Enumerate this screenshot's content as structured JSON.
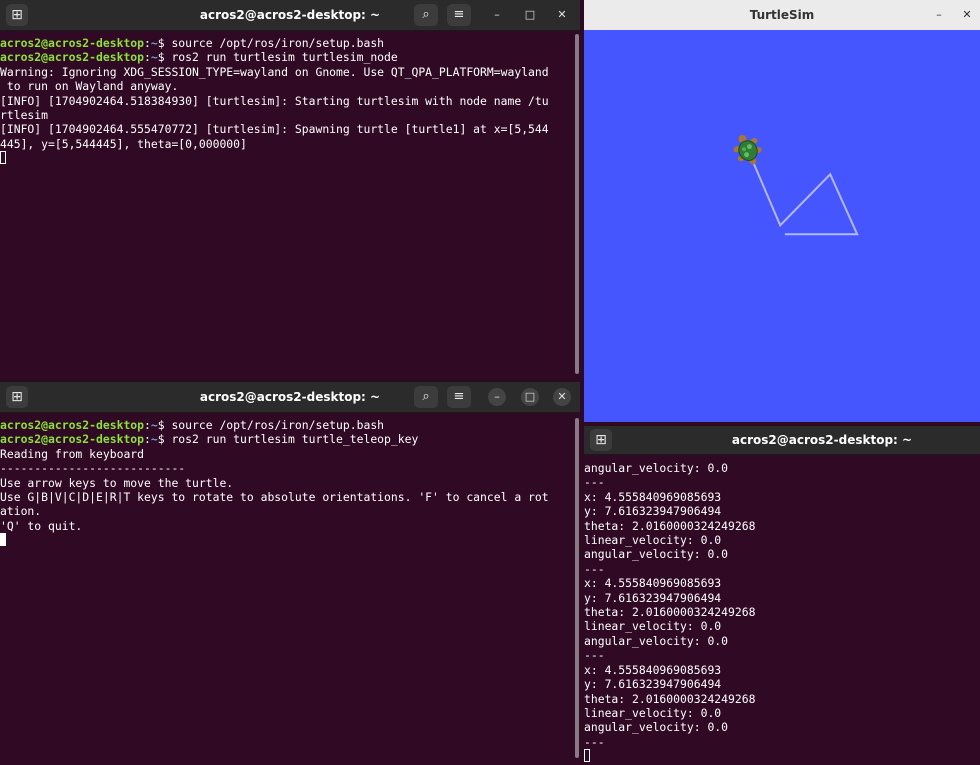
{
  "colors": {
    "terminal_bg": "#300a24",
    "sim_bg": "#4556ff",
    "prompt_user": "#8ae234",
    "prompt_path": "#729fcf",
    "trail": "#b3b8ff"
  },
  "icons": {
    "new_tab": "⊞",
    "search": "⌕",
    "menu": "≡",
    "minimize": "–",
    "maximize": "□",
    "close": "✕"
  },
  "term1": {
    "title": "acros2@acros2-desktop: ~",
    "lines": [
      {
        "user": "acros2@acros2-desktop",
        "colon": ":",
        "path": "~",
        "cmd": "$ source /opt/ros/iron/setup.bash"
      },
      {
        "user": "acros2@acros2-desktop",
        "colon": ":",
        "path": "~",
        "cmd": "$ ros2 run turtlesim turtlesim_node"
      },
      {
        "text": "Warning: Ignoring XDG_SESSION_TYPE=wayland on Gnome. Use QT_QPA_PLATFORM=wayland"
      },
      {
        "text": " to run on Wayland anyway."
      },
      {
        "text": "[INFO] [1704902464.518384930] [turtlesim]: Starting turtlesim with node name /tu"
      },
      {
        "text": "rtlesim"
      },
      {
        "text": "[INFO] [1704902464.555470772] [turtlesim]: Spawning turtle [turtle1] at x=[5,544"
      },
      {
        "text": "445], y=[5,544445], theta=[0,000000]"
      }
    ]
  },
  "term2": {
    "title": "acros2@acros2-desktop: ~",
    "lines": [
      {
        "user": "acros2@acros2-desktop",
        "colon": ":",
        "path": "~",
        "cmd": "$ source /opt/ros/iron/setup.bash"
      },
      {
        "user": "acros2@acros2-desktop",
        "colon": ":",
        "path": "~",
        "cmd": "$ ros2 run turtlesim turtle_teleop_key"
      },
      {
        "text": "Reading from keyboard"
      },
      {
        "text": "---------------------------"
      },
      {
        "text": "Use arrow keys to move the turtle."
      },
      {
        "text": "Use G|B|V|C|D|E|R|T keys to rotate to absolute orientations. 'F' to cancel a rot"
      },
      {
        "text": "ation."
      },
      {
        "text": "'Q' to quit."
      }
    ]
  },
  "term3": {
    "title": "acros2@acros2-desktop: ~",
    "lines": [
      "angular_velocity: 0.0",
      "---",
      "x: 4.555840969085693",
      "y: 7.616323947906494",
      "theta: 2.0160000324249268",
      "linear_velocity: 0.0",
      "angular_velocity: 0.0",
      "---",
      "x: 4.555840969085693",
      "y: 7.616323947906494",
      "theta: 2.0160000324249268",
      "linear_velocity: 0.0",
      "angular_velocity: 0.0",
      "---",
      "x: 4.555840969085693",
      "y: 7.616323947906494",
      "theta: 2.0160000324249268",
      "linear_velocity: 0.0",
      "angular_velocity: 0.0",
      "---"
    ]
  },
  "turtlesim": {
    "title": "TurtleSim",
    "turtle": {
      "x": 4.555840969085693,
      "y": 7.616323947906494,
      "theta": 2.0160000324249268
    },
    "trail": [
      [
        4.56,
        7.62
      ],
      [
        5.45,
        5.52
      ],
      [
        6.84,
        6.95
      ],
      [
        7.59,
        5.27
      ],
      [
        5.58,
        5.27
      ]
    ]
  }
}
